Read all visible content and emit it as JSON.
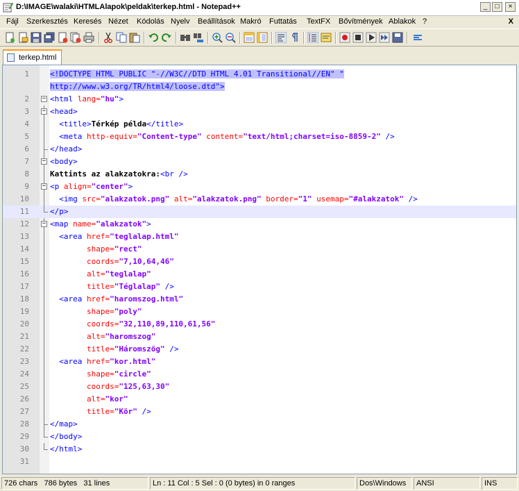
{
  "window": {
    "title": "D:\\IMAGE\\walaki\\HTMLAlapok\\peldak\\terkep.html - Notepad++"
  },
  "menu": [
    "Fájl",
    "Szerkesztés",
    "Keresés",
    "Nézet",
    "Kódolás",
    "Nyelv",
    "Beállítások",
    "Makró",
    "Futtatás",
    "TextFX",
    "Bővítmények",
    "Ablakok",
    "?"
  ],
  "menu_close": "X",
  "tab": {
    "label": "terkep.html"
  },
  "line_numbers": [
    "1",
    "",
    "2",
    "3",
    "4",
    "5",
    "6",
    "7",
    "8",
    "9",
    "10",
    "11",
    "12",
    "13",
    "14",
    "15",
    "16",
    "17",
    "18",
    "19",
    "20",
    "21",
    "22",
    "23",
    "24",
    "25",
    "26",
    "27",
    "28",
    "29",
    "30",
    "31"
  ],
  "code": {
    "l1a": "<!DOCTYPE HTML PUBLIC \"-//W3C//DTD HTML 4.01 Transitional//EN\" \"",
    "l1b": "http://www.w3.org/TR/html4/loose.dtd\">",
    "html_open": "<html",
    "lang_attr": " lang=",
    "lang_val": "\"hu\"",
    "gt": ">",
    "head_open": "<head>",
    "title_open": "<title>",
    "title_text": "Térkép példa",
    "title_close": "</title>",
    "meta_open": "<meta",
    "http_equiv": " http-equiv=",
    "http_equiv_val": "\"Content-type\"",
    "content_attr": " content=",
    "content_val": "\"text/html;charset=iso-8859-2\"",
    "self_close": " />",
    "head_close": "</head>",
    "body_open": "<body>",
    "kattints": "Kattints az alakzatokra:",
    "br": "<br />",
    "p_open": "<p",
    "align_attr": " align=",
    "align_val": "\"center\"",
    "img_open": "<img",
    "src_attr": " src=",
    "src_val": "\"alakzatok.png\"",
    "alt_attr": " alt=",
    "alt_val": "\"alakzatok.png\"",
    "border_attr": " border=",
    "border_val": "\"1\"",
    "usemap_attr": " usemap=",
    "usemap_val": "\"#alakzatok\"",
    "p_close": "</p>",
    "map_open": "<map",
    "name_attr": " name=",
    "name_val": "\"alakzatok\"",
    "area_open": "<area",
    "href_attr": " href=",
    "shape_attr": "shape=",
    "coords_attr": "coords=",
    "alt2_attr": "alt=",
    "title_attr": "title=",
    "a1_href": "\"teglalap.html\"",
    "a1_shape": "\"rect\"",
    "a1_coords": "\"7,10,64,46\"",
    "a1_alt": "\"teglalap\"",
    "a1_title": "\"Téglalap\"",
    "a2_href": "\"haromszog.html\"",
    "a2_shape": "\"poly\"",
    "a2_coords": "\"32,110,89,110,61,56\"",
    "a2_alt": "\"haromszog\"",
    "a2_title": "\"Háromszög\"",
    "a3_href": "\"kor.html\"",
    "a3_shape": "\"circle\"",
    "a3_coords": "\"125,63,30\"",
    "a3_alt": "\"kor\"",
    "a3_title": "\"Kör\"",
    "map_close": "</map>",
    "body_close": "</body>",
    "html_close": "</html>"
  },
  "status": {
    "chars": "726 chars",
    "bytes": "786 bytes",
    "lines": "31 lines",
    "position": "Ln : 11    Col : 5    Sel : 0 (0 bytes) in 0 ranges",
    "eol": "Dos\\Windows",
    "encoding": "ANSI",
    "mode": "INS"
  },
  "colors": {
    "tag": "#0000ff",
    "attribute": "#ff0000",
    "value": "#8000ff",
    "selection": "#c0c0ff",
    "current_line": "#e8e8ff",
    "tab_accent": "#fa9a1e"
  },
  "icons": [
    "new-file-icon",
    "open-file-icon",
    "save-icon",
    "save-all-icon",
    "close-icon",
    "close-all-icon",
    "print-icon",
    "cut-icon",
    "copy-icon",
    "paste-icon",
    "undo-icon",
    "redo-icon",
    "find-icon",
    "replace-icon",
    "zoom-in-icon",
    "zoom-out-icon",
    "sync-vertical-icon",
    "sync-horizontal-icon",
    "word-wrap-icon",
    "show-all-chars-icon",
    "indent-guide-icon",
    "user-lang-icon",
    "record-macro-icon",
    "stop-record-icon",
    "play-macro-icon",
    "run-macro-multiple-icon",
    "save-macro-icon",
    "trim-icon"
  ]
}
